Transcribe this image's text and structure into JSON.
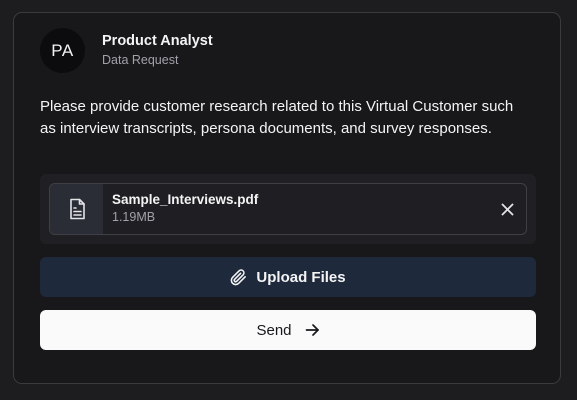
{
  "header": {
    "avatar_initials": "PA",
    "name": "Product Analyst",
    "role": "Data Request"
  },
  "message": "Please provide customer research related to this Virtual Customer such as interview transcripts, persona documents, and survey responses.",
  "attachments": [
    {
      "name": "Sample_Interviews.pdf",
      "size": "1.19MB",
      "icon": "document-icon"
    }
  ],
  "actions": {
    "upload_label": "Upload Files",
    "upload_icon": "paperclip-icon",
    "send_label": "Send",
    "send_icon": "arrow-right-icon"
  },
  "colors": {
    "background": "#18181b",
    "upload_button": "#1e293b",
    "send_button": "#fafafa",
    "muted_text": "#a1a1aa"
  }
}
